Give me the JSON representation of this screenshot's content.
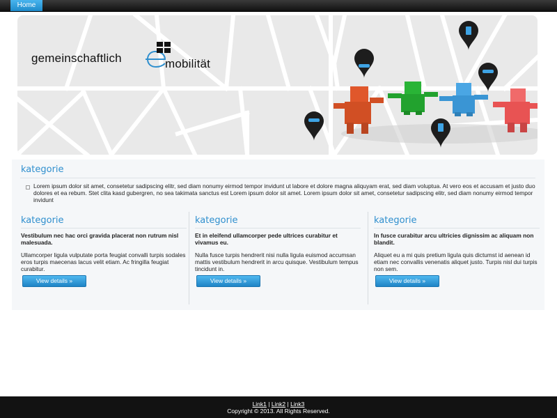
{
  "nav": {
    "home_label": "Home"
  },
  "hero": {
    "logo_word_1": "gemeinschaftlich",
    "logo_letter": "e",
    "logo_word_2": "mobilität",
    "colors": {
      "road": "#ffffff",
      "ground": "#e9e9e9",
      "accent": "#2f8fce"
    },
    "figures": [
      "orange-figure",
      "green-figure",
      "blue-figure",
      "red-figure"
    ],
    "pins": [
      "car-pin",
      "car-pin",
      "car-pin",
      "charging-pin",
      "charging-pin"
    ]
  },
  "intro": {
    "title": "kategorie",
    "text": "Lorem ipsum dolor sit amet, consetetur sadipscing elitr, sed diam nonumy eirmod tempor invidunt ut labore et dolore magna aliquyam erat, sed diam voluptua. At vero eos et accusam et justo duo dolores et ea rebum. Stet clita kasd gubergren, no sea takimata sanctus est Lorem ipsum dolor sit amet. Lorem ipsum dolor sit amet, consetetur sadipscing elitr, sed diam nonumy eirmod tempor invidunt"
  },
  "columns": [
    {
      "title": "kategorie",
      "bold": "Vestibulum nec hac orci gravida placerat non rutrum nisl malesuada.",
      "text": "Ullamcorper ligula vulputate porta feugiat convalli turpis sodales eros turpis maecenas lacus velit etiam. Ac fringilla feugiat curabitur.",
      "button": "View details »"
    },
    {
      "title": "kategorie",
      "bold": "Et in eleifend ullamcorper pede ultrices curabitur et vivamus eu.",
      "text": "Nulla fusce turpis hendrerit nisi nulla ligula euismod accumsan mattis vestibulum hendrerit in arcu quisque. Vestibulum tempus tincidunt in.",
      "button": "View details »"
    },
    {
      "title": "kategorie",
      "bold": "In fusce curabitur arcu ultricies dignissim ac aliquam non blandit.",
      "text": "Aliquet eu a mi quis pretium ligula quis dictumst id aenean id etiam nec convallis venenatis aliquet justo. Turpis nisl dui turpis non sem.",
      "button": "View details »"
    }
  ],
  "footer": {
    "links": [
      "Link1",
      "Link2",
      "Link3"
    ],
    "separator": " | ",
    "copyright": "Copyright © 2013. All Rights Reserved."
  }
}
